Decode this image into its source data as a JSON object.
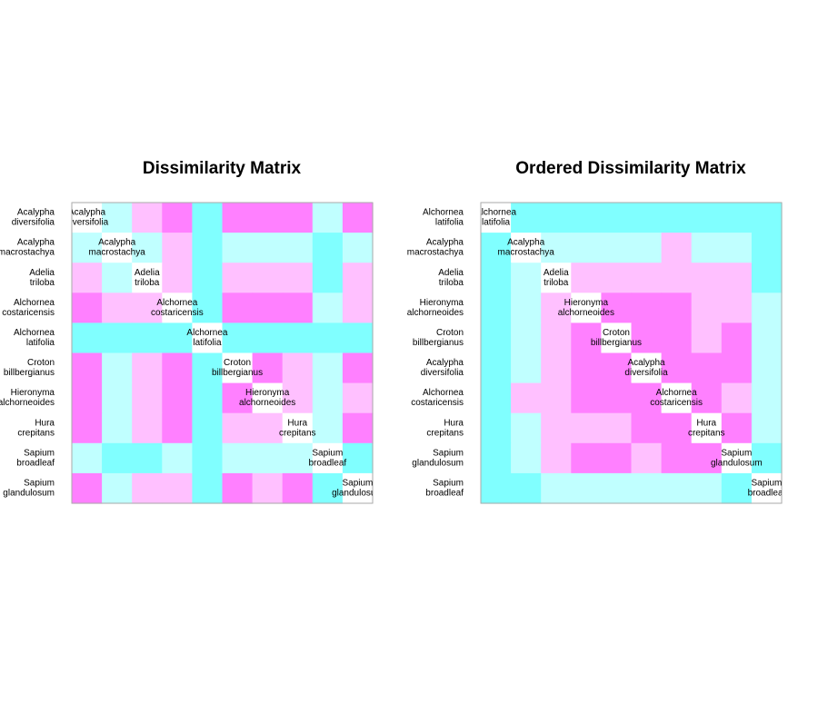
{
  "colors": {
    "1": "#ff80ff",
    "2": "#ffc0ff",
    "3": "#c0ffff",
    "4": "#80ffff",
    "diagonal": "#ffffff",
    "border": "#aaaaaa"
  },
  "chart_data": [
    {
      "type": "heatmap",
      "title": "Dissimilarity Matrix",
      "labels": [
        [
          "Acalypha",
          "diversifolia"
        ],
        [
          "Acalypha",
          "macrostachya"
        ],
        [
          "Adelia",
          "triloba"
        ],
        [
          "Alchornea",
          "costaricensis"
        ],
        [
          "Alchornea",
          "latifolia"
        ],
        [
          "Croton",
          "billbergianus"
        ],
        [
          "Hieronyma",
          "alchorneoides"
        ],
        [
          "Hura",
          "crepitans"
        ],
        [
          "Sapium",
          "broadleaf"
        ],
        [
          "Sapium",
          "glandulosum"
        ]
      ],
      "matrix": [
        [
          0,
          3,
          2,
          1,
          4,
          1,
          1,
          1,
          3,
          1
        ],
        [
          3,
          0,
          3,
          2,
          4,
          3,
          3,
          3,
          4,
          3
        ],
        [
          2,
          3,
          0,
          2,
          4,
          2,
          2,
          2,
          4,
          2
        ],
        [
          1,
          2,
          2,
          0,
          4,
          1,
          1,
          1,
          3,
          2
        ],
        [
          4,
          4,
          4,
          4,
          0,
          4,
          4,
          4,
          4,
          4
        ],
        [
          1,
          3,
          2,
          1,
          4,
          0,
          1,
          2,
          3,
          1
        ],
        [
          1,
          3,
          2,
          1,
          4,
          1,
          0,
          2,
          3,
          2
        ],
        [
          1,
          3,
          2,
          1,
          4,
          2,
          2,
          0,
          3,
          1
        ],
        [
          3,
          4,
          4,
          3,
          4,
          3,
          3,
          3,
          0,
          4
        ],
        [
          1,
          3,
          2,
          2,
          4,
          1,
          2,
          1,
          4,
          0
        ]
      ]
    },
    {
      "type": "heatmap",
      "title": "Ordered Dissimilarity Matrix",
      "labels": [
        [
          "Alchornea",
          "latifolia"
        ],
        [
          "Acalypha",
          "macrostachya"
        ],
        [
          "Adelia",
          "triloba"
        ],
        [
          "Hieronyma",
          "alchorneoides"
        ],
        [
          "Croton",
          "billbergianus"
        ],
        [
          "Acalypha",
          "diversifolia"
        ],
        [
          "Alchornea",
          "costaricensis"
        ],
        [
          "Hura",
          "crepitans"
        ],
        [
          "Sapium",
          "glandulosum"
        ],
        [
          "Sapium",
          "broadleaf"
        ]
      ],
      "matrix": [
        [
          0,
          4,
          4,
          4,
          4,
          4,
          4,
          4,
          4,
          4
        ],
        [
          4,
          0,
          3,
          3,
          3,
          3,
          2,
          3,
          3,
          4
        ],
        [
          4,
          3,
          0,
          2,
          2,
          2,
          2,
          2,
          2,
          4
        ],
        [
          4,
          3,
          2,
          0,
          1,
          1,
          1,
          2,
          2,
          3
        ],
        [
          4,
          3,
          2,
          1,
          0,
          1,
          1,
          2,
          1,
          3
        ],
        [
          4,
          3,
          2,
          1,
          1,
          0,
          1,
          1,
          1,
          3
        ],
        [
          4,
          2,
          2,
          1,
          1,
          1,
          0,
          1,
          2,
          3
        ],
        [
          4,
          3,
          2,
          2,
          2,
          1,
          1,
          0,
          1,
          3
        ],
        [
          4,
          3,
          2,
          1,
          1,
          2,
          1,
          1,
          0,
          4
        ],
        [
          4,
          4,
          3,
          3,
          3,
          3,
          3,
          3,
          4,
          0
        ]
      ]
    }
  ]
}
